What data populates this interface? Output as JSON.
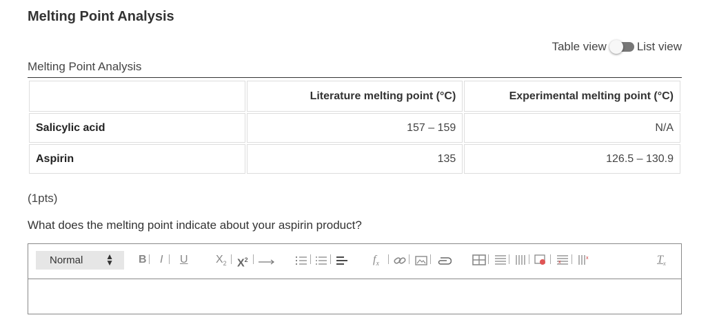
{
  "page": {
    "title": "Melting Point Analysis"
  },
  "view_toggle": {
    "left_label": "Table view",
    "right_label": "List view"
  },
  "section": {
    "label": "Melting Point Analysis"
  },
  "table": {
    "headers": [
      "",
      "Literature melting point (°C)",
      "Experimental melting point (°C)"
    ],
    "rows": [
      {
        "name": "Salicylic acid",
        "literature": "157 – 159",
        "experimental": "N/A"
      },
      {
        "name": "Aspirin",
        "literature": "135",
        "experimental": "126.5 – 130.9"
      }
    ]
  },
  "question": {
    "points": "(1pts)",
    "text": "What does the melting point indicate about your aspirin product?"
  },
  "editor": {
    "format_select": "Normal",
    "answer_value": "",
    "toolbar_icons": [
      "bold-icon",
      "italic-icon",
      "underline-icon",
      "subscript-icon",
      "superscript-icon",
      "arrow-icon",
      "ordered-list-icon",
      "bullet-list-icon",
      "align-icon",
      "formula-icon",
      "link-icon",
      "image-icon",
      "attachment-icon",
      "table-icon",
      "insert-row-icon",
      "insert-column-icon",
      "delete-table-icon",
      "delete-row-icon",
      "delete-column-icon",
      "clear-format-icon"
    ]
  }
}
